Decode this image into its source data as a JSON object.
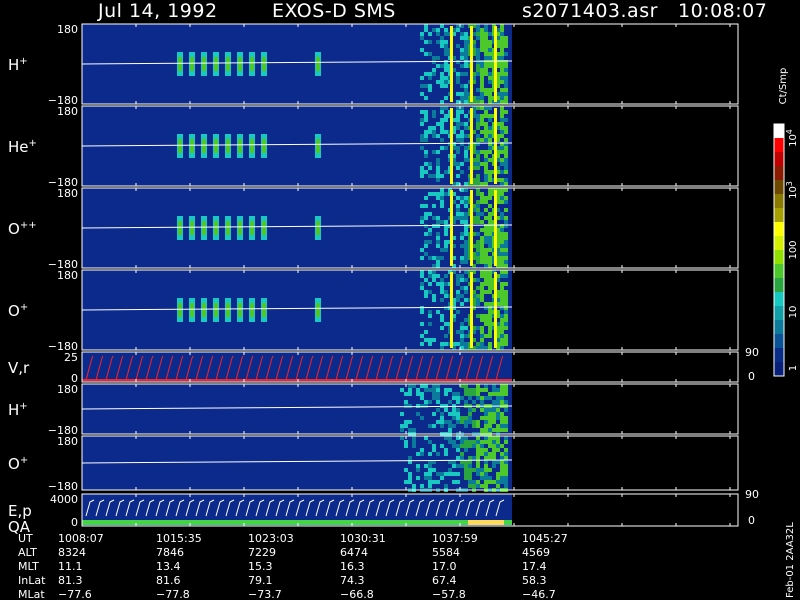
{
  "header": {
    "date": "Jul 14, 1992",
    "instrument": "EXOS-D SMS",
    "file": "s2071403.asr",
    "time": "10:08:07"
  },
  "colors": {
    "background": "#000000",
    "plot_background": "#0c2a8c",
    "trace": "#ffffff",
    "velocity": "#ff2020",
    "qa_bar": "#44d444",
    "qa_highlight": "#ffd95a"
  },
  "panels": [
    {
      "id": "h_plus",
      "label": "H",
      "superscript": "+",
      "ymax": "180",
      "ymin": "−180"
    },
    {
      "id": "he_plus",
      "label": "He",
      "superscript": "+",
      "ymax": "180",
      "ymin": "−180"
    },
    {
      "id": "o_plusplus",
      "label": "O",
      "superscript": "++",
      "ymax": "180",
      "ymin": "−180"
    },
    {
      "id": "o_plus",
      "label": "O",
      "superscript": "+",
      "ymax": "180",
      "ymin": "−180"
    },
    {
      "id": "vr",
      "label": "V,r",
      "superscript": "",
      "ymax": "25",
      "ymin": "0",
      "right_top": "90",
      "right_bottom": "0"
    },
    {
      "id": "h_plus_2",
      "label": "H",
      "superscript": "+",
      "ymax": "180",
      "ymin": "−180"
    },
    {
      "id": "o_plus_2",
      "label": "O",
      "superscript": "+",
      "ymax": "180",
      "ymin": "−180"
    },
    {
      "id": "ep_qa",
      "label": "E,p",
      "label2": "QA",
      "superscript": "",
      "ymax": "4000",
      "ymin": "0",
      "right_top": "90",
      "right_bottom": "0"
    }
  ],
  "colorbar": {
    "units": "Ct/Smp",
    "labels": [
      "10",
      "10",
      "100",
      "10",
      "1"
    ],
    "exponents": [
      "4",
      "3",
      "",
      "",
      ""
    ],
    "colors": [
      "#ffffff",
      "#ff0000",
      "#c00000",
      "#8b1a00",
      "#6e4a00",
      "#8b7a00",
      "#a6a000",
      "#ffff00",
      "#d4f000",
      "#90e000",
      "#4cc82c",
      "#2aa640",
      "#17c9c0",
      "#12a0a8",
      "#0c7a9a",
      "#0a5296",
      "#0a2d88",
      "#08207a"
    ]
  },
  "ephemeris": {
    "rows": [
      {
        "name": "UT",
        "values": [
          "1008:07",
          "1015:35",
          "1023:03",
          "1030:31",
          "1037:59",
          "1045:27"
        ]
      },
      {
        "name": "ALT",
        "values": [
          "8324",
          "7846",
          "7229",
          "6474",
          "5584",
          "4569"
        ]
      },
      {
        "name": "MLT",
        "values": [
          "11.1",
          "13.4",
          "15.3",
          "16.3",
          "17.0",
          "17.4"
        ]
      },
      {
        "name": "InLat",
        "values": [
          "81.3",
          "81.6",
          "79.1",
          "74.3",
          "67.4",
          "58.3"
        ]
      },
      {
        "name": "MLat",
        "values": [
          "−77.6",
          "−77.8",
          "−73.7",
          "−66.8",
          "−57.8",
          "−46.7"
        ]
      }
    ]
  },
  "footer": {
    "side_label": "Feb-01  2AA32L"
  },
  "chart_data": {
    "type": "heatmap",
    "title": "Jul 14, 1992    EXOS-D SMS",
    "x": [
      "1008:07",
      "1015:35",
      "1023:03",
      "1030:31",
      "1037:59",
      "1045:27"
    ],
    "data_end_time": "~1045:27",
    "panels": [
      "H+",
      "He+",
      "O++",
      "O+",
      "V,r",
      "H+",
      "O+",
      "E,p QA"
    ],
    "pitch_angle_range": [
      -180,
      180
    ],
    "velocity_range": [
      0,
      25
    ],
    "energy_range": [
      0,
      4000
    ],
    "color_scale": "log",
    "color_range": [
      1,
      10000
    ],
    "colorbar_ticks": [
      1,
      10,
      100,
      1000,
      10000
    ],
    "units": "Ct/Smp"
  }
}
